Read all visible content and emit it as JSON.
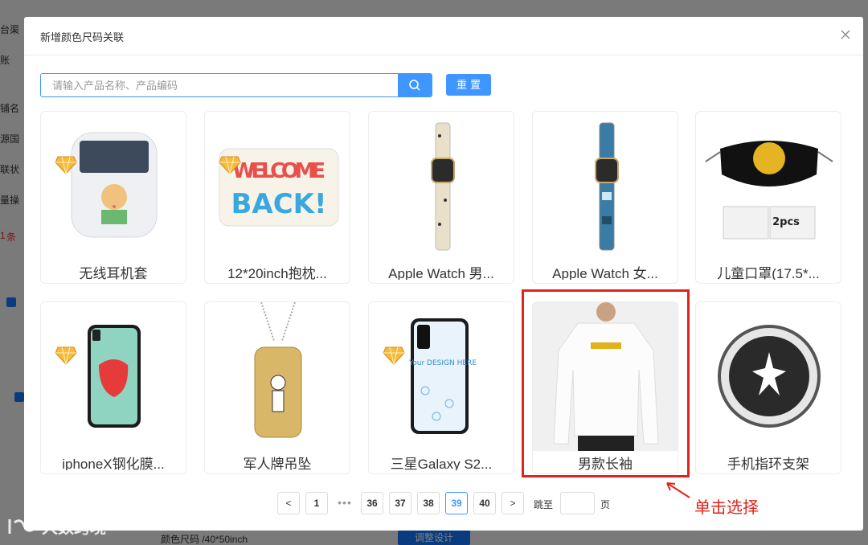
{
  "background": {
    "left_labels": [
      "台渠",
      "账",
      "铺名",
      "源国",
      "联状",
      "量操",
      "条",
      "1"
    ],
    "bottom_text": "颜色尺码 /40*50inch",
    "bottom_button": "调整设计"
  },
  "modal": {
    "title": "新增颜色尺码关联",
    "search": {
      "placeholder": "请输入产品名称、产品编码",
      "value": ""
    },
    "reset_label": "重置",
    "products": [
      {
        "name": "无线耳机套",
        "vip": true
      },
      {
        "name": "12*20inch抱枕...",
        "vip": true,
        "thumb_text": "WELCOME BACK!"
      },
      {
        "name": "Apple Watch 男...",
        "vip": false
      },
      {
        "name": "Apple Watch 女...",
        "vip": false
      },
      {
        "name": "儿童口罩(17.5*...",
        "vip": false,
        "thumb_text": "2pcs"
      },
      {
        "name": "iphoneX钢化膜...",
        "vip": true
      },
      {
        "name": "军人牌吊坠",
        "vip": false
      },
      {
        "name": "三星Galaxy S2...",
        "vip": true,
        "thumb_text": "Your DESIGN HERE"
      },
      {
        "name": "男款长袖",
        "vip": false,
        "selected": true
      },
      {
        "name": "手机指环支架",
        "vip": false
      }
    ],
    "pagination": {
      "prev": "<",
      "next": ">",
      "pages": [
        "1",
        "36",
        "37",
        "38",
        "39",
        "40"
      ],
      "ellipsis": "•••",
      "current": "39",
      "jump_label": "跳至",
      "page_label": "页",
      "jump_value": ""
    }
  },
  "annotation": {
    "callout_text": "单击选择",
    "color": "#e0241b"
  },
  "watermark": "大数跨境",
  "colors": {
    "primary": "#4096ff",
    "highlight": "#e0241b"
  }
}
